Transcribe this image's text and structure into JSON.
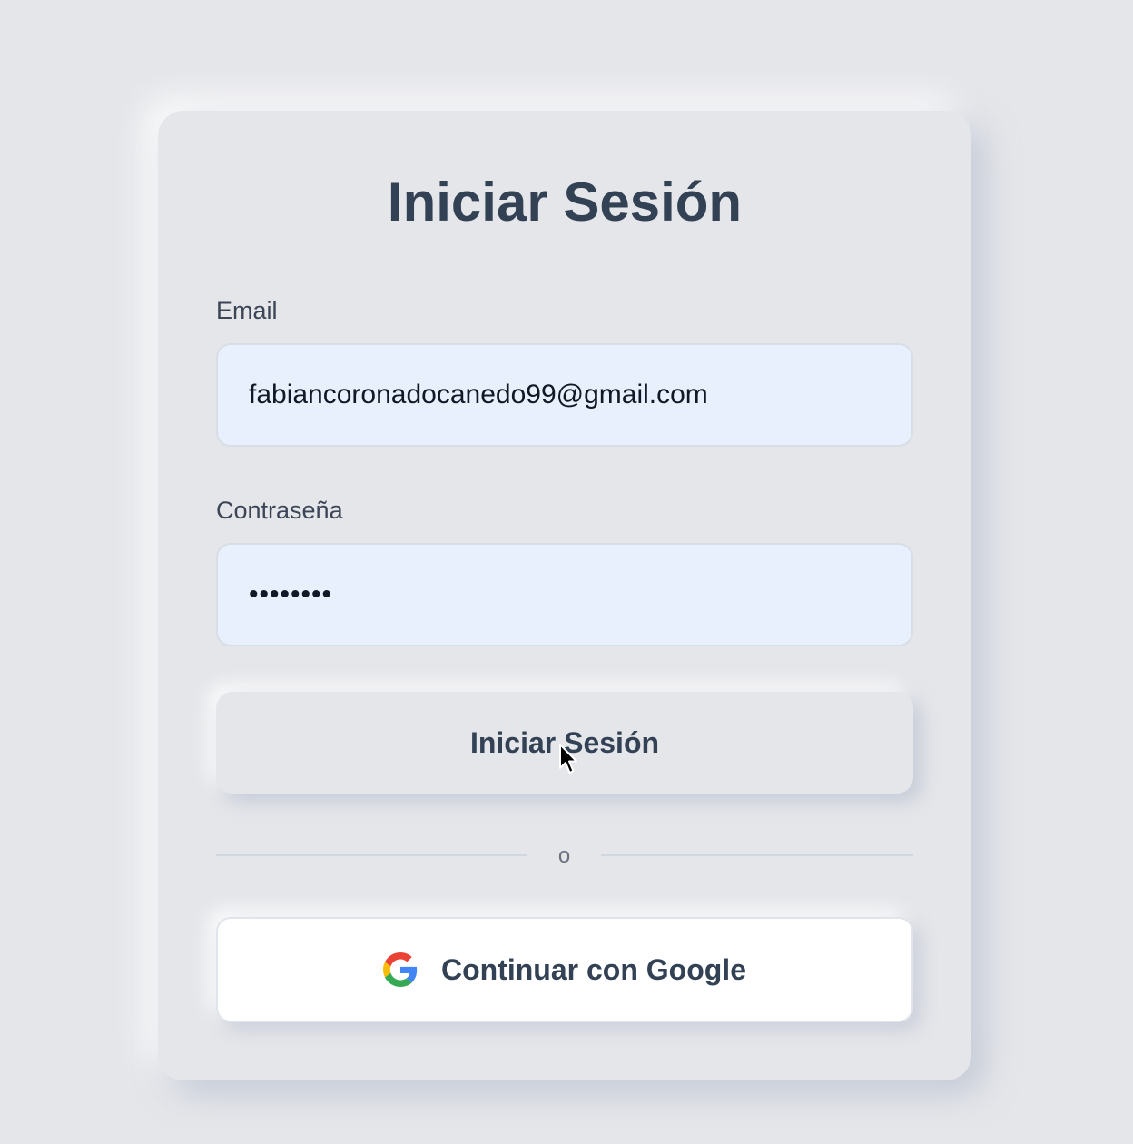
{
  "login": {
    "title": "Iniciar Sesión",
    "email_label": "Email",
    "email_value": "fabiancoronadocanedo99@gmail.com",
    "password_label": "Contraseña",
    "password_value": "abcdefgh",
    "submit_label": "Iniciar Sesión",
    "divider_text": "o",
    "google_label": "Continuar con Google"
  },
  "icons": {
    "google": "google-icon",
    "cursor": "mouse-cursor-icon"
  },
  "colors": {
    "background": "#e5e6ea",
    "text_primary": "#334155",
    "input_bg": "#e8f0fd",
    "google_blue": "#4285F4",
    "google_red": "#EA4335",
    "google_yellow": "#FBBC05",
    "google_green": "#34A853"
  }
}
